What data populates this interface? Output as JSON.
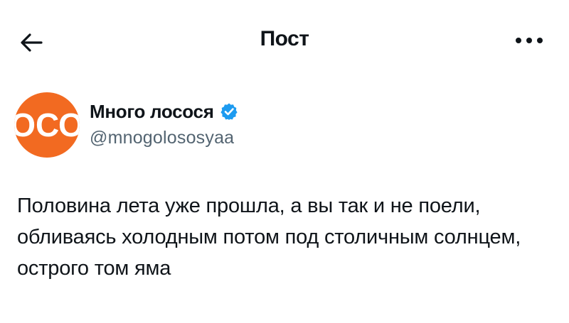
{
  "header": {
    "back_icon": "arrow-left-icon",
    "title": "Пост",
    "more_icon": "more-horizontal-icon"
  },
  "author": {
    "avatar_text": "ОСО",
    "avatar_color": "#f26a21",
    "name": "Много лосося",
    "verified_icon": "verified-badge-icon",
    "verified_color": "#1d9bf0",
    "handle": "@mnogolososyaa"
  },
  "tweet": {
    "text": "Половина лета уже прошла, а вы так и не поели, обливаясь холодным потом под столичным солнцем, острого том яма"
  }
}
